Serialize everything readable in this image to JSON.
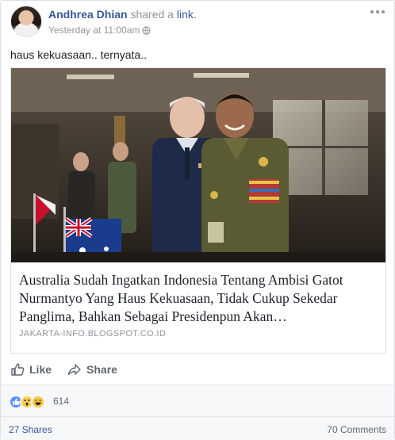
{
  "post": {
    "author": "Andhrea Dhian",
    "shared_text": "shared a",
    "shared_link_text": "link.",
    "timestamp": "Yesterday at 11:00am",
    "message": "haus kekuasaan.. ternyata..",
    "link": {
      "title": "Australia Sudah Ingatkan Indonesia Tentang Ambisi Gatot Nurmantyo Yang Haus Kekuasaan, Tidak Cukup Sekedar Panglima, Bahkan Sebagai Presidenpun Akan…",
      "domain": "JAKARTA-INFO.BLOGSPOT.CO.ID"
    }
  },
  "actions": {
    "like_label": "Like",
    "share_label": "Share"
  },
  "stats": {
    "reactions_count": "614",
    "shares": "27 Shares",
    "comments": "70 Comments"
  },
  "colors": {
    "link_blue": "#365899",
    "meta_gray": "#90949c",
    "like_blue": "#5890ff"
  }
}
